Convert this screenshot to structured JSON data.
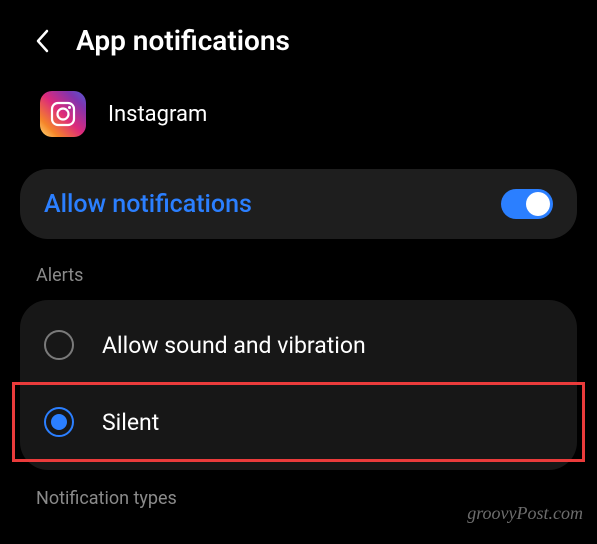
{
  "header": {
    "title": "App notifications"
  },
  "app": {
    "name": "Instagram"
  },
  "allow": {
    "label": "Allow notifications",
    "enabled": true
  },
  "sections": {
    "alerts_label": "Alerts",
    "types_label": "Notification types"
  },
  "alerts": {
    "options": [
      {
        "label": "Allow sound and vibration",
        "selected": false
      },
      {
        "label": "Silent",
        "selected": true
      }
    ]
  },
  "watermark": "groovyPost.com"
}
